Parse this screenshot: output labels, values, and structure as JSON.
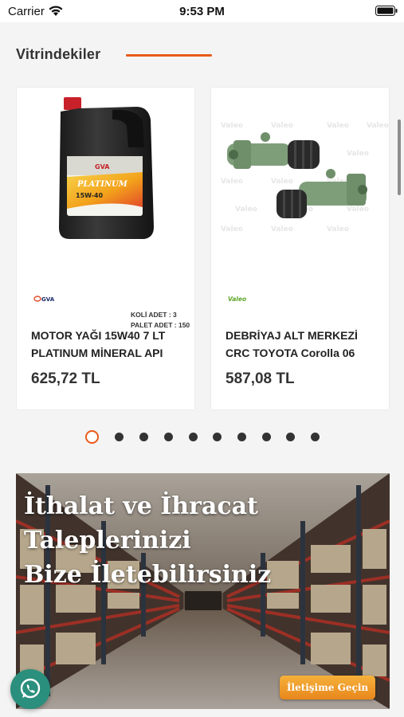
{
  "status_bar": {
    "carrier": "Carrier",
    "time": "9:53 PM"
  },
  "section": {
    "title": "Vitrindekiler",
    "accent_color": "#e85a1a"
  },
  "products": [
    {
      "name": "MOTOR YAĞI 15W40 7 LT PLATINUM MİNERAL API",
      "price": "625,72 TL",
      "brand": "GVA",
      "image_label": "PLATINUM",
      "image_grade": "15W-40",
      "packaging": [
        "KOLİ ADET   :  3",
        "PALET ADET : 150"
      ]
    },
    {
      "name": "DEBRİYAJ ALT MERKEZİ CRC TOYOTA Corolla 06",
      "price": "587,08 TL",
      "brand": "Valeo",
      "watermark": "Valeo"
    }
  ],
  "carousel": {
    "page_count": 10,
    "active_index": 0
  },
  "banner": {
    "headline": [
      "İthalat ve İhracat",
      "Taleplerinizi",
      "Bize İletebilirsiniz"
    ],
    "cta_label": "İletişime Geçin"
  },
  "floating": {
    "icon": "whatsapp-icon"
  }
}
